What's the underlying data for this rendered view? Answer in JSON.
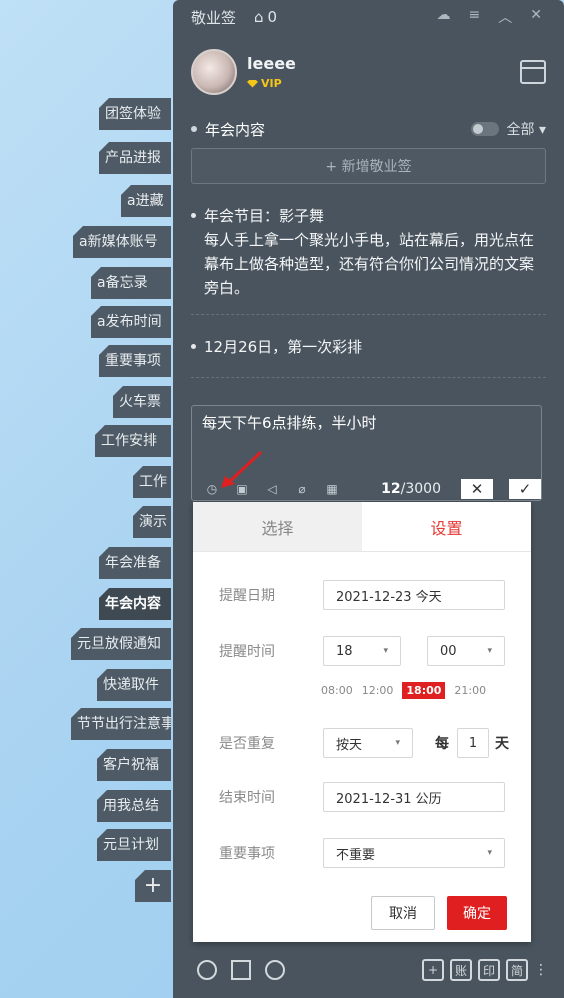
{
  "app": {
    "title": "敬业签",
    "bell_count": "0",
    "icons": [
      "cloud-icon",
      "menu-icon",
      "collapse-icon",
      "close-icon"
    ]
  },
  "user": {
    "name": "leeee",
    "badge": "VIP"
  },
  "categories": [
    "团签体验",
    "产品进报",
    "a进藏",
    "a新媒体账号",
    "a备忘录",
    "a发布时间",
    "重要事项",
    "火车票",
    "工作安排",
    "工作",
    "演示",
    "年会准备",
    "年会内容",
    "元旦放假通知",
    "快递取件",
    "节节出行注意事项",
    "客户祝福",
    "用我总结",
    "元旦计划",
    "+"
  ],
  "list": {
    "title": "年会内容",
    "filter": "全部",
    "new_task": "+ 新增敬业签"
  },
  "notes": [
    {
      "text": "年会节目：影子舞\n每人手上拿一个聚光小手电，站在幕后，用光点在幕布上做各种造型，还有符合你们公司情况的文案旁白。"
    },
    {
      "text": "12月26日，第一次彩排"
    }
  ],
  "editor": {
    "text": "每天下午6点排练，半小时",
    "count": "12",
    "max": "/3000",
    "cancel_symbol": "✕",
    "confirm_symbol": "✓"
  },
  "reminder": {
    "tab_select": "选择",
    "tab_settings": "设置",
    "date_label": "提醒日期",
    "date_value": "2021-12-23 今天",
    "time_label": "提醒时间",
    "hour": "18",
    "minute": "00",
    "quick_times": [
      "08:00",
      "12:00",
      "18:00",
      "21:00"
    ],
    "quick_selected": "18:00",
    "repeat_label": "是否重复",
    "repeat_value": "按天",
    "every": "每",
    "interval": "1",
    "unit": "天",
    "end_label": "结束时间",
    "end_value": "2021-12-31 公历",
    "important_label": "重要事项",
    "important_value": "不重要",
    "cancel": "取消",
    "confirm": "确定"
  },
  "bottom": {
    "icons": [
      "clock-icon",
      "calendar-check-icon",
      "search-icon"
    ],
    "right_buttons": [
      "+",
      "账",
      "印",
      "简"
    ]
  },
  "colors": {
    "panel": "#49545e",
    "accent": "#e02020",
    "tab": "#4e5b66"
  }
}
